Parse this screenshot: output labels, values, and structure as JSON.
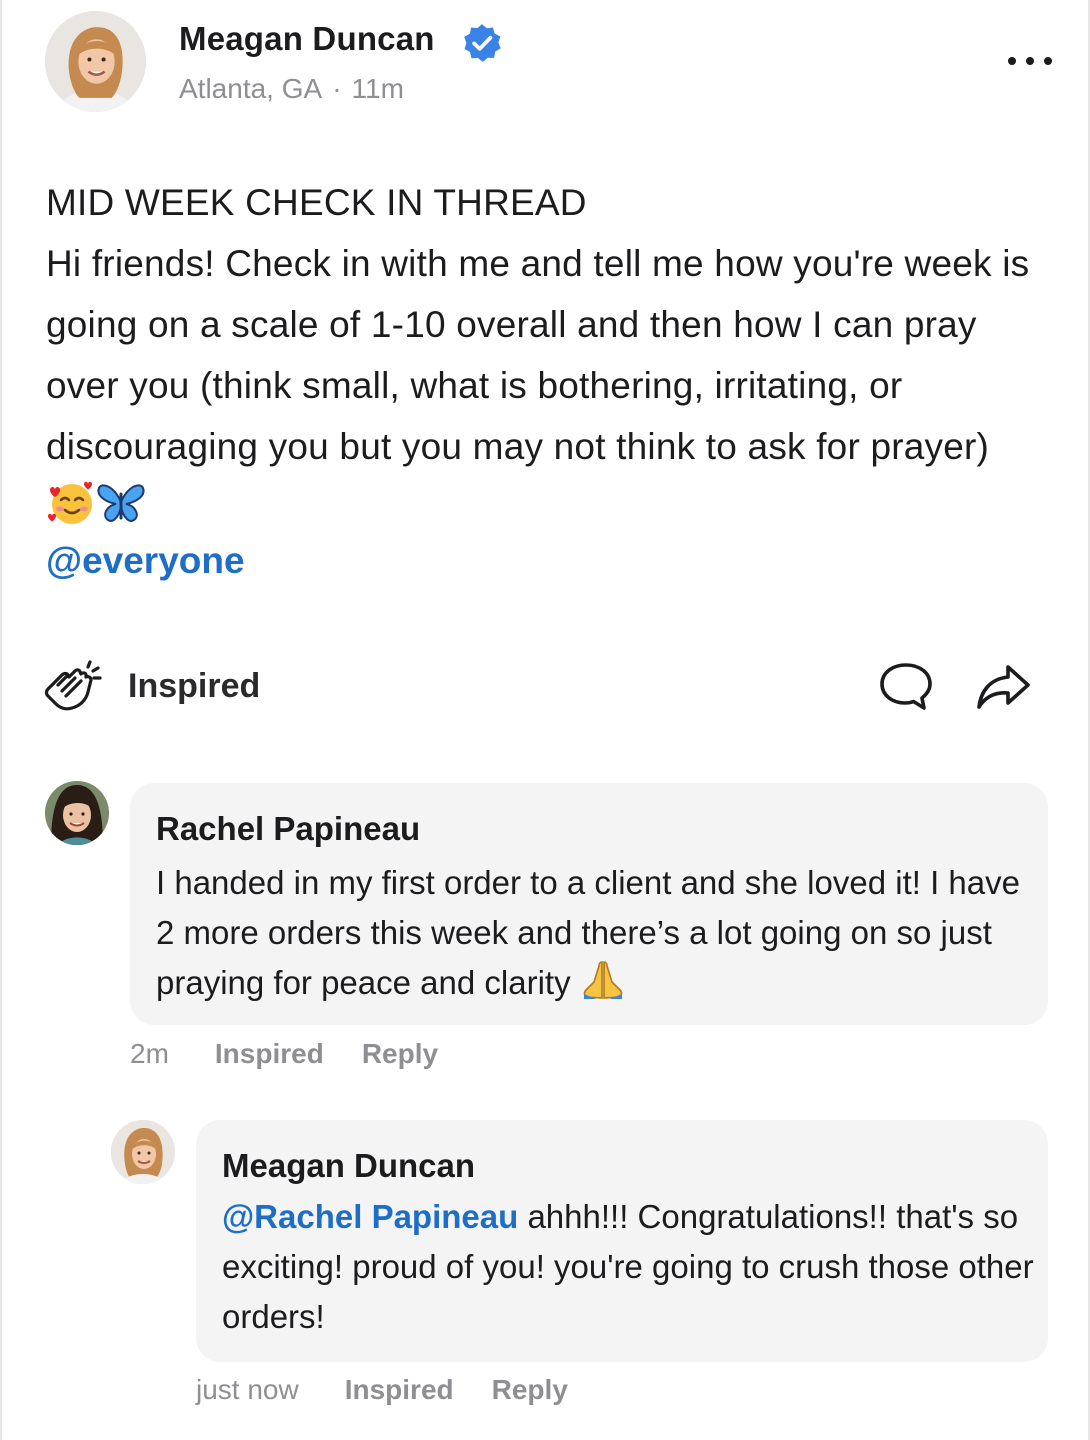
{
  "post": {
    "author": {
      "name": "Meagan Duncan",
      "verified": true,
      "location": "Atlanta, GA",
      "time": "11m"
    },
    "title": "MID WEEK CHECK IN THREAD",
    "body": "Hi friends! Check in with me and tell me how you're week is going on a scale of 1-10 overall and then how I can pray over you (think small, what is bothering, irritating, or discouraging you but you may not think to ask for prayer)",
    "mention": "@everyone",
    "reaction_label": "Inspired"
  },
  "comments": [
    {
      "author": "Rachel Papineau",
      "text": "I handed in my first order to a client and she loved it! I have 2 more orders this week and there’s a lot going on so just praying for peace and clarity",
      "time": "2m",
      "inspired_label": "Inspired",
      "reply_label": "Reply"
    },
    {
      "author": "Meagan Duncan",
      "mention": "@Rachel Papineau",
      "text": "ahhh!!! Congratulations!! that's so exciting! proud of you! you're going to crush those other orders!",
      "time": "just now",
      "inspired_label": "Inspired",
      "reply_label": "Reply"
    }
  ],
  "colors": {
    "accent": "#1f6ec6",
    "verified_badge": "#3b82e6",
    "muted_text": "#8e8e93",
    "bubble_bg": "#f4f4f5"
  },
  "icons": [
    "verified-badge-icon",
    "more-options-icon",
    "clapping-hands-icon",
    "comment-icon",
    "share-icon",
    "smiling-face-with-hearts-emoji",
    "butterfly-emoji",
    "folded-hands-emoji"
  ]
}
